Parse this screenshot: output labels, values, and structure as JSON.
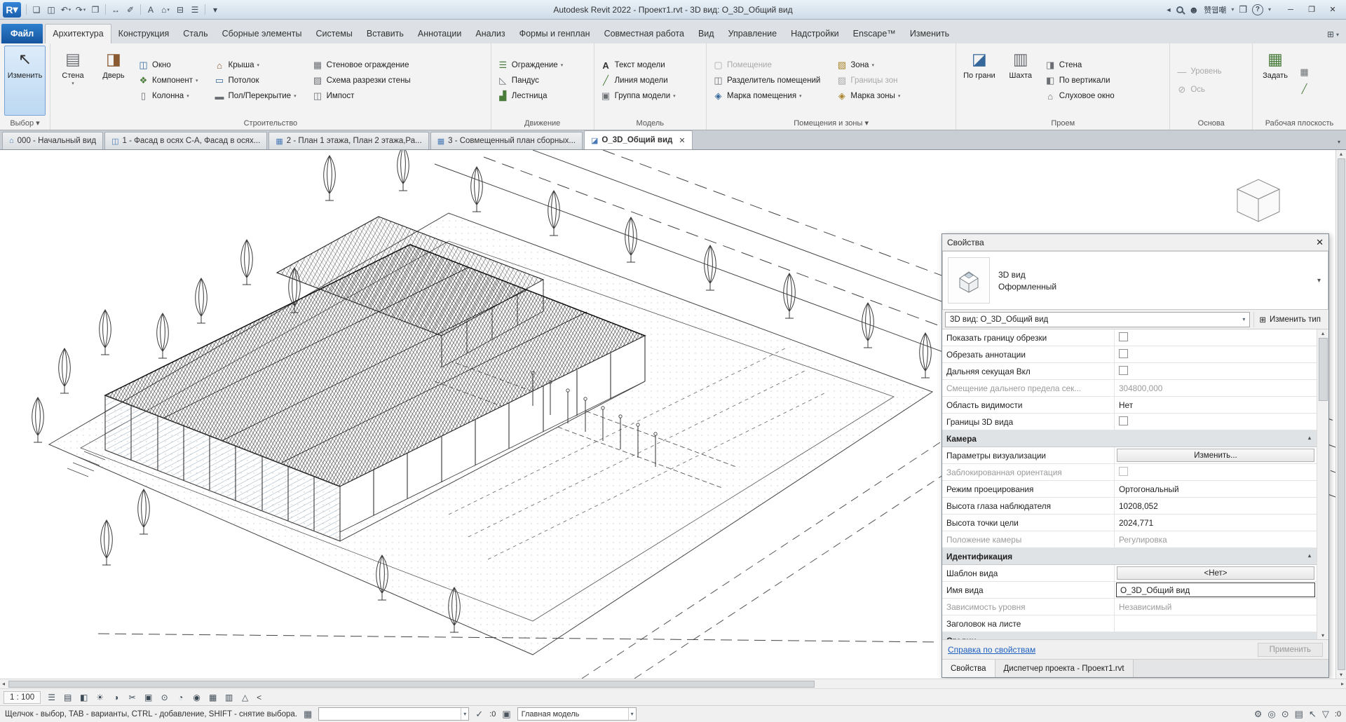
{
  "ui": {
    "dd": "▾",
    "up": "▴",
    "down": "▾",
    "left": "◂",
    "right": "▸"
  },
  "titlebar": {
    "logo": "R",
    "qat": [
      {
        "glyph": "❏"
      },
      {
        "glyph": "◫"
      },
      {
        "glyph": "↶"
      },
      {
        "glyph": "↷"
      },
      {
        "glyph": "❒"
      },
      {
        "glyph": "↔"
      },
      {
        "glyph": "✐"
      },
      {
        "glyph": "A"
      },
      {
        "glyph": "⌂"
      },
      {
        "glyph": "⊟"
      },
      {
        "glyph": "☰"
      },
      {
        "glyph": "▾"
      }
    ],
    "title": "Autodesk Revit 2022 - Проект1.rvt - 3D вид: O_3D_Общий вид",
    "collapse_arrow": "◄",
    "user_name": "赞웹嘲",
    "app_store_glyph": "❒",
    "help_glyph": "?",
    "win_min": "─",
    "win_max": "❐",
    "win_close": "✕"
  },
  "ribbon": {
    "tabs": [
      "Файл",
      "Архитектура",
      "Конструкция",
      "Сталь",
      "Сборные элементы",
      "Системы",
      "Вставить",
      "Аннотации",
      "Анализ",
      "Формы и генплан",
      "Совместная работа",
      "Вид",
      "Управление",
      "Надстройки",
      "Enscape™",
      "Изменить"
    ],
    "extra_icon": "⊞",
    "panels": [
      {
        "label": "Выбор ▾",
        "big": [
          {
            "label": "Изменить",
            "glyph": "↖"
          }
        ]
      },
      {
        "label": "Строительство",
        "big": [
          {
            "label": "Стена",
            "glyph": "▤"
          },
          {
            "label": "Дверь",
            "glyph": "◨"
          }
        ],
        "small": [
          {
            "label": "Окно",
            "glyph": "◫"
          },
          {
            "label": "Компонент",
            "glyph": "❖"
          },
          {
            "label": "Колонна",
            "glyph": "▯"
          },
          {
            "label": "Крыша",
            "glyph": "⌂"
          },
          {
            "label": "Потолок",
            "glyph": "▭"
          },
          {
            "label": "Пол/Перекрытие",
            "glyph": "▬"
          },
          {
            "label": "Стеновое ограждение",
            "glyph": "▦"
          },
          {
            "label": "Схема разрезки стены",
            "glyph": "▨"
          },
          {
            "label": "Импост",
            "glyph": "◫"
          }
        ]
      },
      {
        "label": "Движение",
        "small": [
          {
            "label": "Ограждение",
            "glyph": "☰"
          },
          {
            "label": "Пандус",
            "glyph": "◺"
          },
          {
            "label": "Лестница",
            "glyph": "▟"
          }
        ]
      },
      {
        "label": "Модель",
        "small": [
          {
            "label": "Текст модели",
            "glyph": "A"
          },
          {
            "label": "Линия модели",
            "glyph": "╱"
          },
          {
            "label": "Группа модели",
            "glyph": "▣"
          }
        ]
      },
      {
        "label": "Помещения и зоны ▾",
        "small": [
          {
            "label": "Помещение",
            "glyph": "▢"
          },
          {
            "label": "Разделитель помещений",
            "glyph": "◫"
          },
          {
            "label": "Марка помещения",
            "glyph": "◈"
          },
          {
            "label": "Зона",
            "glyph": "▧"
          },
          {
            "label": "Границы зон",
            "glyph": "▨"
          },
          {
            "label": "Марка зоны",
            "glyph": "◈"
          }
        ]
      },
      {
        "label": "Проем",
        "big": [
          {
            "label": "По грани",
            "glyph": "◪"
          },
          {
            "label": "Шахта",
            "glyph": "▥"
          }
        ],
        "small": [
          {
            "label": "Стена",
            "glyph": "◨"
          },
          {
            "label": "По вертикали",
            "glyph": "◧"
          },
          {
            "label": "Слуховое окно",
            "glyph": "⌂"
          }
        ]
      },
      {
        "label": "Основа",
        "small": [
          {
            "label": "Уровень",
            "glyph": "―"
          },
          {
            "label": "Ось",
            "glyph": "⊘"
          }
        ]
      },
      {
        "label": "Рабочая плоскость",
        "big": [
          {
            "label": "Задать",
            "glyph": "▦"
          }
        ],
        "small": [
          {
            "label": "",
            "glyph": "▦"
          },
          {
            "label": "",
            "glyph": "╱"
          }
        ]
      }
    ]
  },
  "view_tabs": [
    {
      "glyph": "⌂",
      "label": "000 - Начальный вид"
    },
    {
      "glyph": "◫",
      "label": "1 - Фасад в осях С-А, Фасад в осях..."
    },
    {
      "glyph": "▦",
      "label": "2 - План 1 этажа, План 2 этажа,Ра..."
    },
    {
      "glyph": "▦",
      "label": "3 - Совмещенный план сборных..."
    },
    {
      "glyph": "◪",
      "label": "O_3D_Общий вид",
      "close": "✕"
    }
  ],
  "properties": {
    "header": "Свойства",
    "close": "✕",
    "type_category": "3D вид",
    "type_name": "Оформленный",
    "selector": "3D вид: O_3D_Общий вид",
    "edit_type_icon": "⊞",
    "edit_type_label": "Изменить тип",
    "rows": [
      {
        "label": "Показать границу обрезки"
      },
      {
        "label": "Обрезать аннотации"
      },
      {
        "label": "Дальняя секущая Вкл"
      },
      {
        "label": "Смещение дальнего предела сек...",
        "value": "304800,000"
      },
      {
        "label": "Область видимости",
        "value": "Нет"
      },
      {
        "label": "Границы 3D вида"
      },
      {
        "label": "Камера"
      },
      {
        "label": "Параметры визуализации",
        "value": "Изменить..."
      },
      {
        "label": "Заблокированная ориентация"
      },
      {
        "label": "Режим проецирования",
        "value": "Ортогональный"
      },
      {
        "label": "Высота глаза наблюдателя",
        "value": "10208,052"
      },
      {
        "label": "Высота точки цели",
        "value": "2024,771"
      },
      {
        "label": "Положение камеры",
        "value": "Регулировка"
      },
      {
        "label": "Идентификация"
      },
      {
        "label": "Шаблон вида",
        "value": "<Нет>"
      },
      {
        "label": "Имя вида",
        "value": "O_3D_Общий вид"
      },
      {
        "label": "Зависимость уровня",
        "value": "Независимый"
      },
      {
        "label": "Заголовок на листе",
        "value": ""
      },
      {
        "label": "Стадии"
      }
    ],
    "help_link": "Справка по свойствам",
    "apply_label": "Применить",
    "tabs": [
      "Свойства",
      "Диспетчер проекта - Проект1.rvt"
    ]
  },
  "viewbar": {
    "scale": "1 : 100",
    "icons": [
      "☰",
      "▤",
      "◧",
      "☀",
      "◑",
      "✂",
      "▣",
      "⊙",
      "◔",
      "◉",
      "▦",
      "▥",
      "△"
    ],
    "collapse": "<"
  },
  "statusbar": {
    "hint": "Щелчок - выбор, TAB - варианты, CTRL - добавление, SHIFT - снятие выбора.",
    "workset_icon": "▦",
    "workset_value": "",
    "editable_icon": "✓",
    "editable_count": ":0",
    "design_icon": "▣",
    "design_value": "Главная модель",
    "right_icons": [
      "⚙",
      "◎",
      "⊙",
      "▤",
      "↖"
    ],
    "filter_icon": "▽",
    "filter_count": ":0"
  }
}
